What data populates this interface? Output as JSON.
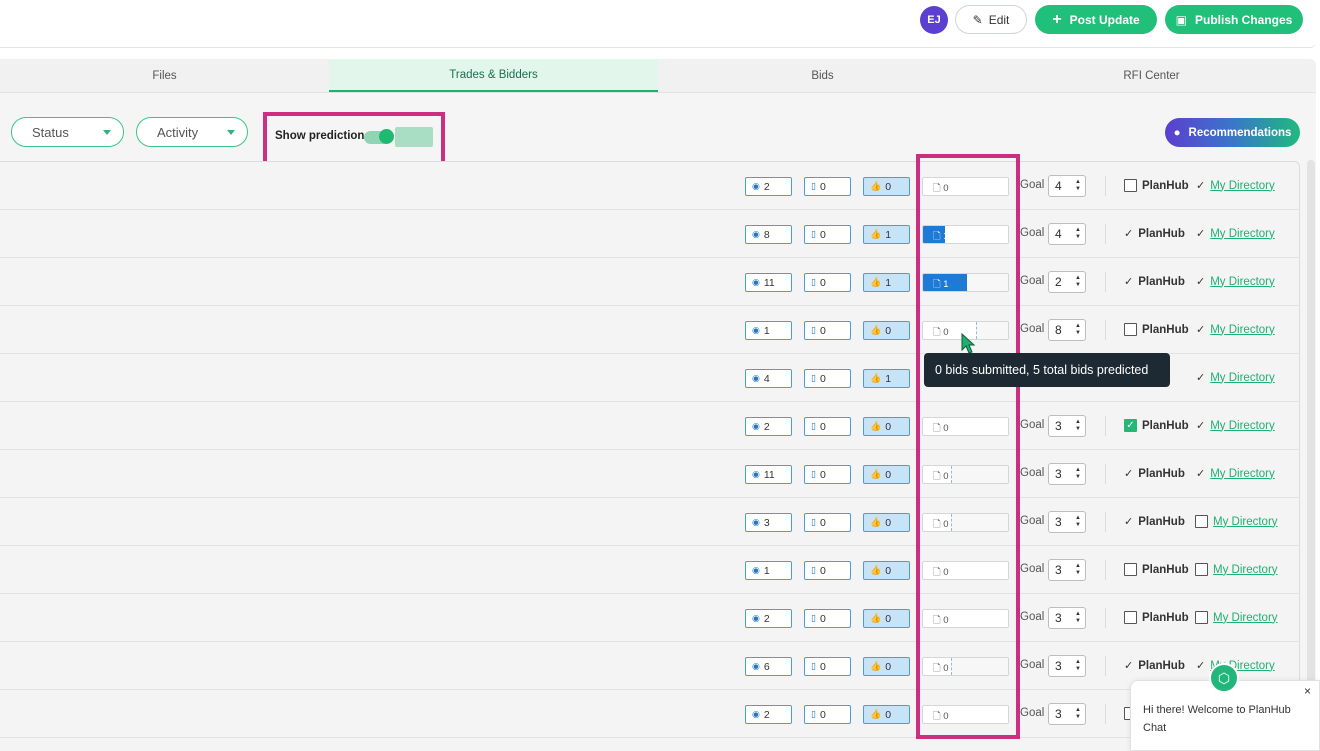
{
  "header": {
    "avatar_initials": "EJ",
    "edit_label": "Edit",
    "post_update_label": "Post Update",
    "publish_label": "Publish Changes"
  },
  "tabs": [
    {
      "label": "Files"
    },
    {
      "label": "Trades & Bidders",
      "active": true
    },
    {
      "label": "Bids"
    },
    {
      "label": "RFI Center"
    }
  ],
  "filters": {
    "status_label": "Status",
    "activity_label": "Activity",
    "show_predictions_label": "Show predictions",
    "show_predictions_on": true
  },
  "recommendations_label": "Recommendations",
  "rows": [
    {
      "views": "2",
      "saves": "0",
      "likes": "0",
      "bids": "0",
      "submitted": 0,
      "predicted": 1.0,
      "goal": "4",
      "planhub": "unchecked",
      "my_directory": "tick"
    },
    {
      "views": "8",
      "saves": "0",
      "likes": "1",
      "bids": "1",
      "submitted": 0.25,
      "predicted": 1.0,
      "goal": "4",
      "planhub": "tick",
      "my_directory": "tick"
    },
    {
      "views": "11",
      "saves": "0",
      "likes": "1",
      "bids": "1",
      "submitted": 0.5,
      "predicted": 0.5,
      "goal": "2",
      "planhub": "tick",
      "my_directory": "tick"
    },
    {
      "views": "1",
      "saves": "0",
      "likes": "0",
      "bids": "0",
      "submitted": 0,
      "predicted": 0.625,
      "goal": "8",
      "planhub": "unchecked",
      "my_directory": "tick"
    },
    {
      "views": "4",
      "saves": "0",
      "likes": "1",
      "bids": "",
      "submitted": 0,
      "predicted": 0,
      "goal": "",
      "planhub": "hidden",
      "my_directory": "tick"
    },
    {
      "views": "2",
      "saves": "0",
      "likes": "0",
      "bids": "0",
      "submitted": 0,
      "predicted": 1.0,
      "goal": "3",
      "planhub": "checked",
      "my_directory": "tick"
    },
    {
      "views": "11",
      "saves": "0",
      "likes": "0",
      "bids": "0",
      "submitted": 0,
      "predicted": 0.33,
      "goal": "3",
      "planhub": "tick",
      "my_directory": "tick"
    },
    {
      "views": "3",
      "saves": "0",
      "likes": "0",
      "bids": "0",
      "submitted": 0,
      "predicted": 0.33,
      "goal": "3",
      "planhub": "tick",
      "my_directory": "unchecked"
    },
    {
      "views": "1",
      "saves": "0",
      "likes": "0",
      "bids": "0",
      "submitted": 0,
      "predicted": 1.0,
      "goal": "3",
      "planhub": "unchecked",
      "my_directory": "unchecked"
    },
    {
      "views": "2",
      "saves": "0",
      "likes": "0",
      "bids": "0",
      "submitted": 0,
      "predicted": 1.0,
      "goal": "3",
      "planhub": "unchecked",
      "my_directory": "unchecked"
    },
    {
      "views": "6",
      "saves": "0",
      "likes": "0",
      "bids": "0",
      "submitted": 0,
      "predicted": 0.33,
      "goal": "3",
      "planhub": "tick",
      "my_directory": "tick"
    },
    {
      "views": "2",
      "saves": "0",
      "likes": "0",
      "bids": "0",
      "submitted": 0,
      "predicted": 1.0,
      "goal": "3",
      "planhub": "unchecked",
      "my_directory": "hidden"
    }
  ],
  "column_labels": {
    "goal": "Goal",
    "planhub": "PlanHub",
    "my_directory": "My Directory"
  },
  "tooltip": "0 bids submitted, 5 total bids predicted",
  "chat": {
    "message": "Hi there! Welcome to PlanHub Chat",
    "close": "×"
  },
  "colors": {
    "brand_green": "#21c07a",
    "highlight_pink": "#cc2e80",
    "bid_blue": "#1f7ad6",
    "avatar_purple": "#5b3fd0"
  }
}
